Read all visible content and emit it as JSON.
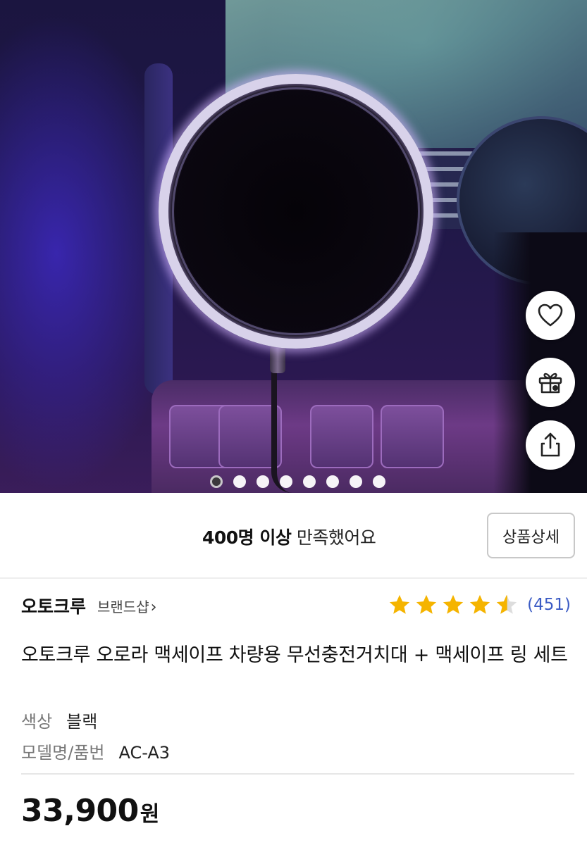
{
  "gallery": {
    "total_images": 8,
    "active_index": 0
  },
  "actions": {
    "like_icon": "heart-icon",
    "gift_icon": "gift-icon",
    "share_icon": "share-icon"
  },
  "satisfaction": {
    "highlight": "400명 이상",
    "rest": " 만족했어요",
    "detail_button": "상품상세"
  },
  "brand": {
    "name": "오토크루",
    "shop_link": "브랜드샵"
  },
  "rating": {
    "score": 4.5,
    "max": 5,
    "count_text": "(451)",
    "star_color": "#f5b400"
  },
  "product": {
    "title": "오토크루 오로라 맥세이프 차량용 무선충전거치대 + 맥세이프 링 세트",
    "options": [
      {
        "key": "색상",
        "value": "블랙"
      },
      {
        "key": "모델명/품번",
        "value": "AC-A3"
      }
    ],
    "price_value": "33,900",
    "price_unit": "원"
  },
  "colors": {
    "rating_link": "#3b5bc4"
  }
}
